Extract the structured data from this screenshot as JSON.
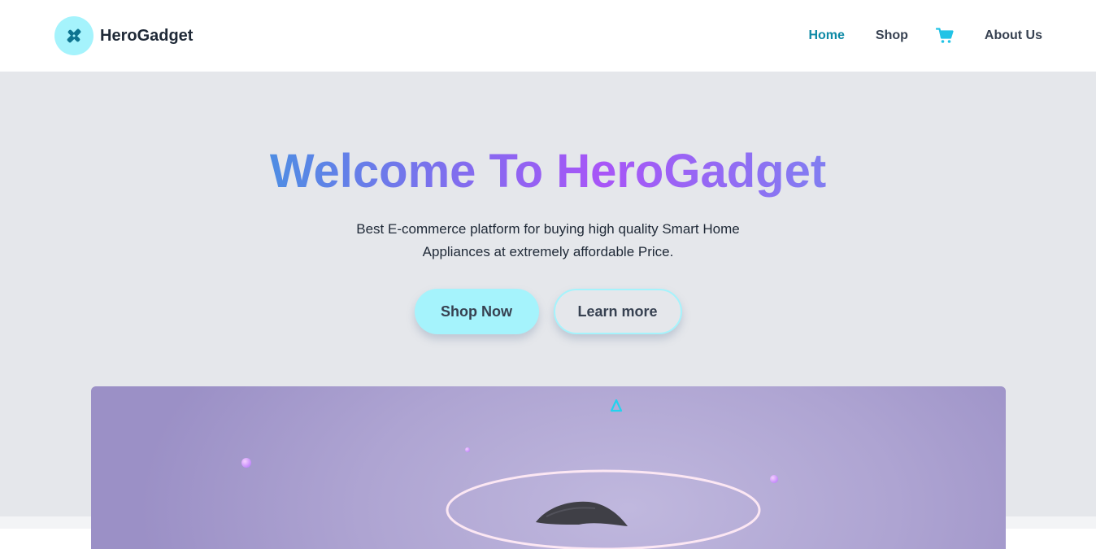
{
  "brand": {
    "name": "HeroGadget",
    "logo_icon": "wrench-cross-icon"
  },
  "nav": {
    "items": [
      {
        "label": "Home",
        "active": true
      },
      {
        "label": "Shop",
        "active": false
      },
      {
        "label": "About Us",
        "active": false
      }
    ],
    "cart_icon": "cart-icon"
  },
  "hero": {
    "title": "Welcome To HeroGadget",
    "subtitle": "Best E-commerce platform for buying high quality Smart Home Appliances at extremely affordable Price.",
    "primary_button": "Shop Now",
    "secondary_button": "Learn more"
  },
  "colors": {
    "accent": "#a5f3fc",
    "active_link": "#0e8aa6",
    "hero_bg": "#e5e7eb",
    "gradient_start": "#4a90e2",
    "gradient_mid": "#a855f7"
  }
}
